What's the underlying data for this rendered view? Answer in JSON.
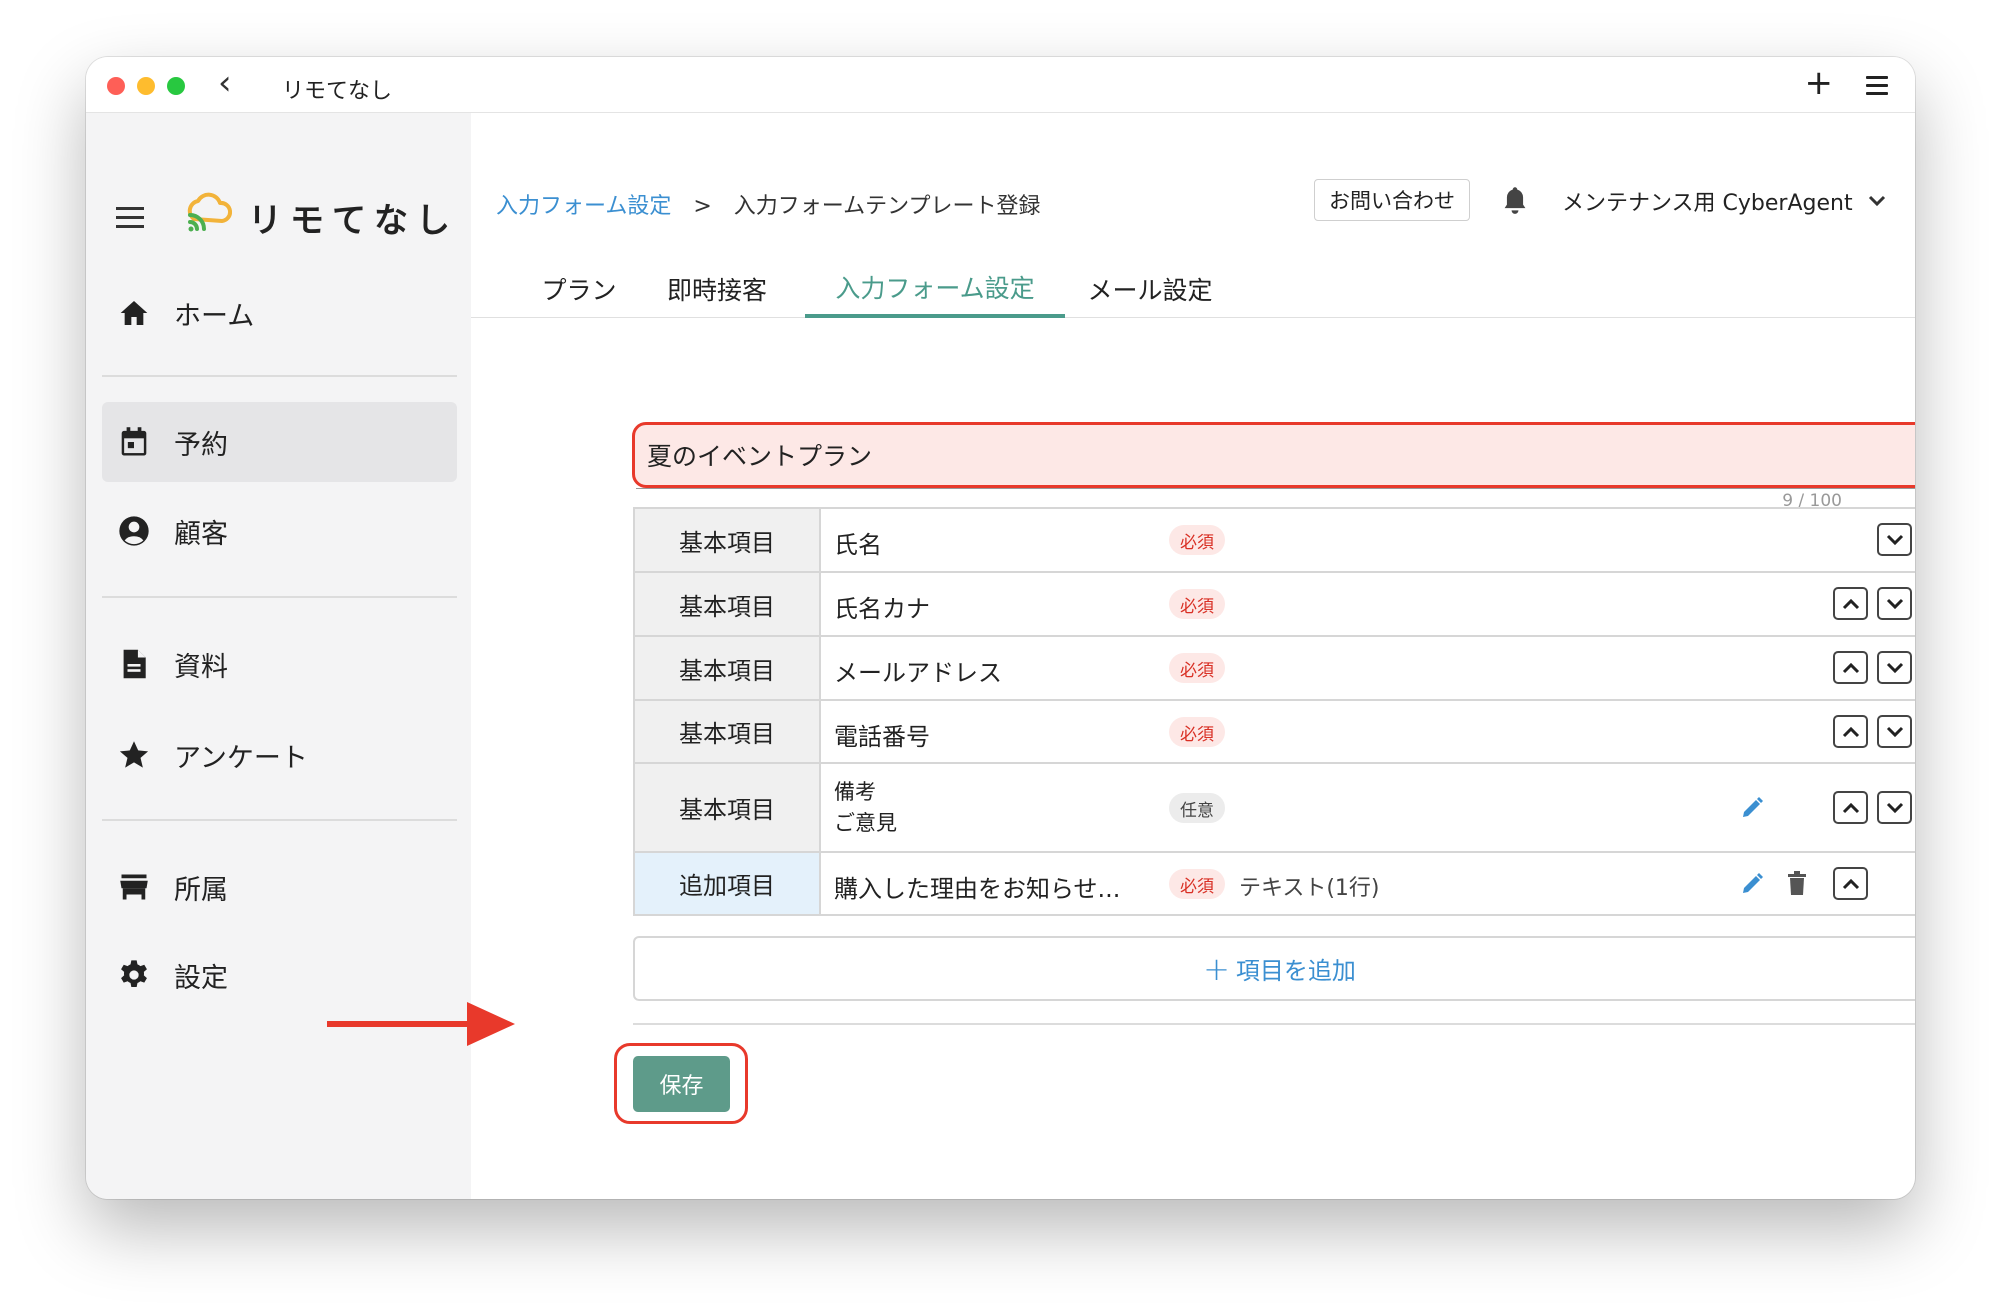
{
  "window": {
    "title": "リモてなし",
    "back_icon": "chevron-left-icon",
    "new_tab_icon": "plus-icon",
    "menu_icon": "menu-icon"
  },
  "sidebar": {
    "logo_text": "リモてなし",
    "items": [
      {
        "label": "ホーム",
        "icon": "home-icon"
      },
      {
        "label": "予約",
        "icon": "calendar-icon",
        "active": true
      },
      {
        "label": "顧客",
        "icon": "account-circle-icon"
      },
      {
        "label": "資料",
        "icon": "document-icon"
      },
      {
        "label": "アンケート",
        "icon": "star-icon"
      },
      {
        "label": "所属",
        "icon": "store-icon"
      },
      {
        "label": "設定",
        "icon": "gear-icon"
      }
    ]
  },
  "header": {
    "breadcrumb": {
      "parent": "入力フォーム設定",
      "separator": ">",
      "current": "入力フォームテンプレート登録"
    },
    "contact_label": "お問い合わせ",
    "user_name": "メンテナンス用 CyberAgent"
  },
  "tabs": [
    {
      "label": "プラン"
    },
    {
      "label": "即時接客"
    },
    {
      "label": "入力フォーム設定",
      "active": true
    },
    {
      "label": "メール設定"
    }
  ],
  "template_name": {
    "value": "夏のイベントプラン",
    "count": "9 / 100"
  },
  "fields": [
    {
      "category": "基本項目",
      "name": "氏名",
      "badge": "必須",
      "required": true
    },
    {
      "category": "基本項目",
      "name": "氏名カナ",
      "badge": "必須",
      "required": true
    },
    {
      "category": "基本項目",
      "name": "メールアドレス",
      "badge": "必須",
      "required": true
    },
    {
      "category": "基本項目",
      "name": "電話番号",
      "badge": "必須",
      "required": true
    },
    {
      "category": "基本項目",
      "name_line1": "備考",
      "name_line2": "ご意見",
      "badge": "任意",
      "required": false
    },
    {
      "category": "追加項目",
      "name": "購入した理由をお知らせ...",
      "badge": "必須",
      "required": true,
      "type": "テキスト(1行)"
    }
  ],
  "add_item_label": "項目を追加",
  "save_label": "保存",
  "colors": {
    "accent": "#4a9b8b",
    "save_button": "#5e9b8a",
    "link": "#3b8fd1",
    "highlight": "#e8392b"
  }
}
